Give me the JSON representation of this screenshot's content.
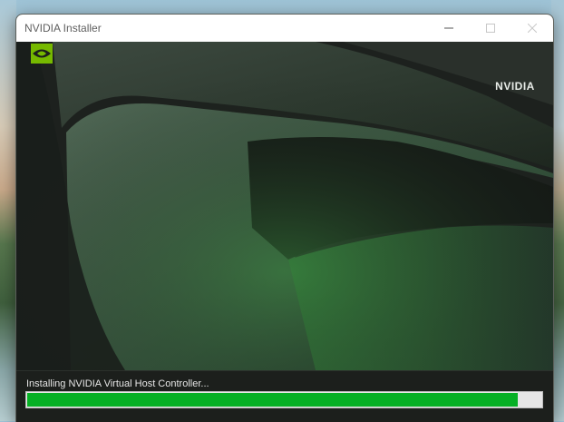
{
  "window": {
    "title": "NVIDIA Installer",
    "controls": {
      "minimize_icon": "minimize-icon",
      "maximize_icon": "maximize-icon",
      "close_icon": "close-icon"
    }
  },
  "branding": {
    "logo_text": "NVIDIA",
    "logo_icon": "nvidia-eye-icon",
    "accent_color": "#76b900"
  },
  "install": {
    "status_text": "Installing NVIDIA Virtual Host Controller...",
    "progress_fraction": 0.955,
    "progress_color": "#06b025"
  }
}
